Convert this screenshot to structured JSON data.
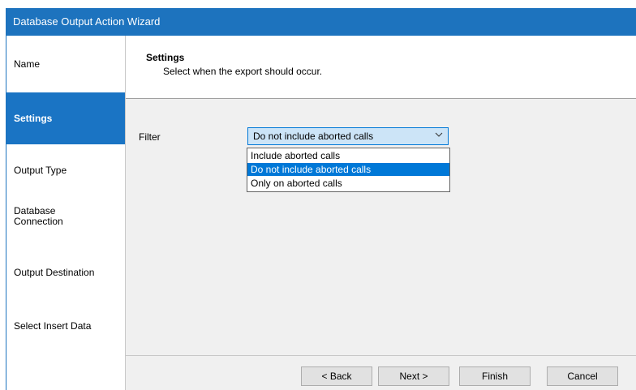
{
  "window": {
    "title": "Database Output Action Wizard"
  },
  "nav": {
    "items": [
      {
        "label": "Name"
      },
      {
        "label": "Settings"
      },
      {
        "label": "Output Type"
      },
      {
        "label": "Database Connection"
      },
      {
        "label": "Output Destination"
      },
      {
        "label": "Select Insert Data"
      }
    ],
    "active": "Settings"
  },
  "header": {
    "title": "Settings",
    "subtitle": "Select when the export should occur."
  },
  "filter": {
    "label": "Filter",
    "selected": "Do not include aborted calls",
    "options": [
      "Include aborted calls",
      "Do not include aborted calls",
      "Only on aborted calls"
    ],
    "dropdown_open": true
  },
  "buttons": {
    "back": "< Back",
    "next": "Next >",
    "finish": "Finish",
    "cancel": "Cancel"
  },
  "colors": {
    "titlebar": "#1d73be",
    "nav_active": "#1a74c4",
    "selection": "#0078d7",
    "combo_bg": "#cce4f7"
  },
  "icons": {
    "combo_arrow": "chevron-down-icon"
  }
}
